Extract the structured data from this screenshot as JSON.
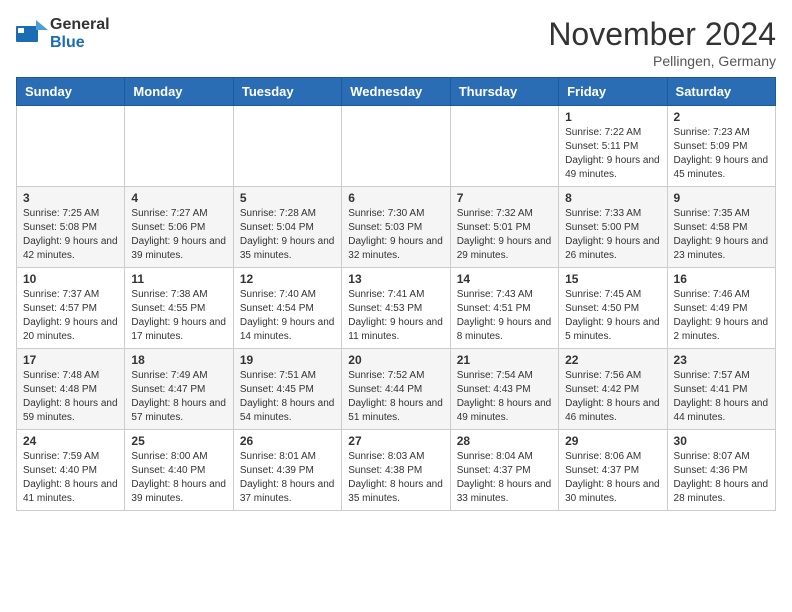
{
  "logo": {
    "general": "General",
    "blue": "Blue"
  },
  "title": "November 2024",
  "location": "Pellingen, Germany",
  "weekdays": [
    "Sunday",
    "Monday",
    "Tuesday",
    "Wednesday",
    "Thursday",
    "Friday",
    "Saturday"
  ],
  "weeks": [
    [
      {
        "day": "",
        "info": ""
      },
      {
        "day": "",
        "info": ""
      },
      {
        "day": "",
        "info": ""
      },
      {
        "day": "",
        "info": ""
      },
      {
        "day": "",
        "info": ""
      },
      {
        "day": "1",
        "info": "Sunrise: 7:22 AM\nSunset: 5:11 PM\nDaylight: 9 hours and 49 minutes."
      },
      {
        "day": "2",
        "info": "Sunrise: 7:23 AM\nSunset: 5:09 PM\nDaylight: 9 hours and 45 minutes."
      }
    ],
    [
      {
        "day": "3",
        "info": "Sunrise: 7:25 AM\nSunset: 5:08 PM\nDaylight: 9 hours and 42 minutes."
      },
      {
        "day": "4",
        "info": "Sunrise: 7:27 AM\nSunset: 5:06 PM\nDaylight: 9 hours and 39 minutes."
      },
      {
        "day": "5",
        "info": "Sunrise: 7:28 AM\nSunset: 5:04 PM\nDaylight: 9 hours and 35 minutes."
      },
      {
        "day": "6",
        "info": "Sunrise: 7:30 AM\nSunset: 5:03 PM\nDaylight: 9 hours and 32 minutes."
      },
      {
        "day": "7",
        "info": "Sunrise: 7:32 AM\nSunset: 5:01 PM\nDaylight: 9 hours and 29 minutes."
      },
      {
        "day": "8",
        "info": "Sunrise: 7:33 AM\nSunset: 5:00 PM\nDaylight: 9 hours and 26 minutes."
      },
      {
        "day": "9",
        "info": "Sunrise: 7:35 AM\nSunset: 4:58 PM\nDaylight: 9 hours and 23 minutes."
      }
    ],
    [
      {
        "day": "10",
        "info": "Sunrise: 7:37 AM\nSunset: 4:57 PM\nDaylight: 9 hours and 20 minutes."
      },
      {
        "day": "11",
        "info": "Sunrise: 7:38 AM\nSunset: 4:55 PM\nDaylight: 9 hours and 17 minutes."
      },
      {
        "day": "12",
        "info": "Sunrise: 7:40 AM\nSunset: 4:54 PM\nDaylight: 9 hours and 14 minutes."
      },
      {
        "day": "13",
        "info": "Sunrise: 7:41 AM\nSunset: 4:53 PM\nDaylight: 9 hours and 11 minutes."
      },
      {
        "day": "14",
        "info": "Sunrise: 7:43 AM\nSunset: 4:51 PM\nDaylight: 9 hours and 8 minutes."
      },
      {
        "day": "15",
        "info": "Sunrise: 7:45 AM\nSunset: 4:50 PM\nDaylight: 9 hours and 5 minutes."
      },
      {
        "day": "16",
        "info": "Sunrise: 7:46 AM\nSunset: 4:49 PM\nDaylight: 9 hours and 2 minutes."
      }
    ],
    [
      {
        "day": "17",
        "info": "Sunrise: 7:48 AM\nSunset: 4:48 PM\nDaylight: 8 hours and 59 minutes."
      },
      {
        "day": "18",
        "info": "Sunrise: 7:49 AM\nSunset: 4:47 PM\nDaylight: 8 hours and 57 minutes."
      },
      {
        "day": "19",
        "info": "Sunrise: 7:51 AM\nSunset: 4:45 PM\nDaylight: 8 hours and 54 minutes."
      },
      {
        "day": "20",
        "info": "Sunrise: 7:52 AM\nSunset: 4:44 PM\nDaylight: 8 hours and 51 minutes."
      },
      {
        "day": "21",
        "info": "Sunrise: 7:54 AM\nSunset: 4:43 PM\nDaylight: 8 hours and 49 minutes."
      },
      {
        "day": "22",
        "info": "Sunrise: 7:56 AM\nSunset: 4:42 PM\nDaylight: 8 hours and 46 minutes."
      },
      {
        "day": "23",
        "info": "Sunrise: 7:57 AM\nSunset: 4:41 PM\nDaylight: 8 hours and 44 minutes."
      }
    ],
    [
      {
        "day": "24",
        "info": "Sunrise: 7:59 AM\nSunset: 4:40 PM\nDaylight: 8 hours and 41 minutes."
      },
      {
        "day": "25",
        "info": "Sunrise: 8:00 AM\nSunset: 4:40 PM\nDaylight: 8 hours and 39 minutes."
      },
      {
        "day": "26",
        "info": "Sunrise: 8:01 AM\nSunset: 4:39 PM\nDaylight: 8 hours and 37 minutes."
      },
      {
        "day": "27",
        "info": "Sunrise: 8:03 AM\nSunset: 4:38 PM\nDaylight: 8 hours and 35 minutes."
      },
      {
        "day": "28",
        "info": "Sunrise: 8:04 AM\nSunset: 4:37 PM\nDaylight: 8 hours and 33 minutes."
      },
      {
        "day": "29",
        "info": "Sunrise: 8:06 AM\nSunset: 4:37 PM\nDaylight: 8 hours and 30 minutes."
      },
      {
        "day": "30",
        "info": "Sunrise: 8:07 AM\nSunset: 4:36 PM\nDaylight: 8 hours and 28 minutes."
      }
    ]
  ]
}
